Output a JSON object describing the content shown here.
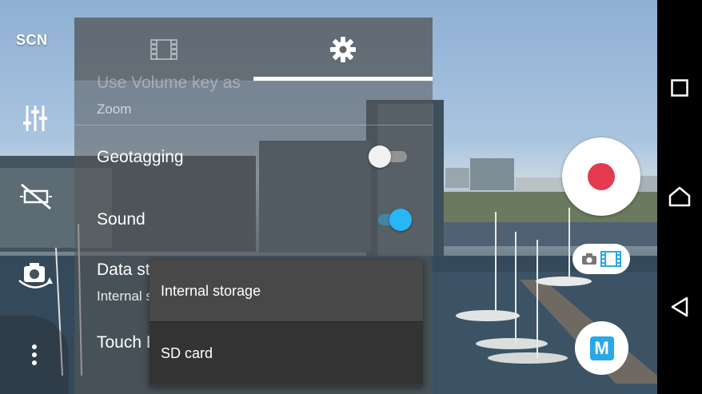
{
  "camera": {
    "scene_label": "SCN",
    "left_icons": [
      "manual-adjust-icon",
      "flash-off-icon",
      "switch-camera-icon",
      "more-options-icon"
    ]
  },
  "settings_panel": {
    "tabs": [
      {
        "name": "video-tab",
        "icon": "film-icon",
        "selected": false
      },
      {
        "name": "settings-tab",
        "icon": "gear-icon",
        "selected": true
      }
    ],
    "rows": {
      "volume_key": {
        "label": "Use Volume key as",
        "value": "Zoom"
      },
      "geotagging": {
        "label": "Geotagging",
        "enabled": false
      },
      "sound": {
        "label": "Sound",
        "enabled": true
      },
      "data_storage": {
        "label": "Data storage",
        "value": "Internal storage"
      },
      "touch_block": {
        "label": "Touch Block"
      }
    }
  },
  "storage_popup": {
    "options": [
      "Internal storage",
      "SD card"
    ],
    "selected": "Internal storage"
  },
  "controls": {
    "record_color": "#e53950",
    "manual_mode_label": "M",
    "accent": "#29b6f6"
  },
  "navbar": {
    "buttons": [
      "recents-icon",
      "home-icon",
      "back-icon"
    ]
  }
}
